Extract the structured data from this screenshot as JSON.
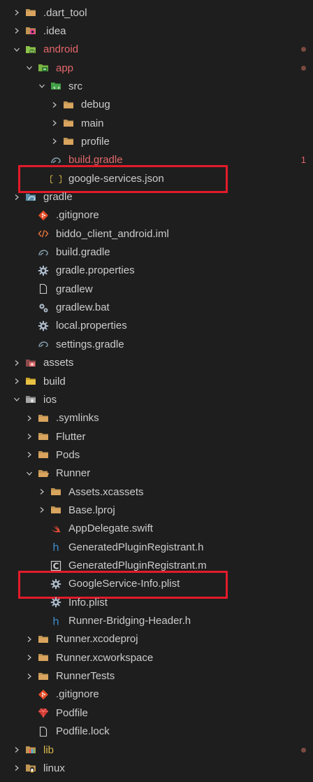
{
  "colors": {
    "background": "#1e1e1e",
    "text": "#cccccc",
    "modified_text": "#e4676b",
    "untracked_text": "#d9b84c",
    "highlight_box": "#e21b2a"
  },
  "tree": [
    {
      "label": ".dart_tool",
      "depth": 0,
      "chevron": "right",
      "icon": "folder-icon"
    },
    {
      "label": ".idea",
      "depth": 0,
      "chevron": "right",
      "icon": "idea-folder-icon"
    },
    {
      "label": "android",
      "depth": 0,
      "chevron": "down",
      "icon": "android-folder-icon",
      "status": "modified",
      "badge": "dot"
    },
    {
      "label": "app",
      "depth": 1,
      "chevron": "down",
      "icon": "app-folder-icon",
      "status": "modified",
      "badge": "dot"
    },
    {
      "label": "src",
      "depth": 2,
      "chevron": "down",
      "icon": "src-folder-icon"
    },
    {
      "label": "debug",
      "depth": 3,
      "chevron": "right",
      "icon": "folder-icon"
    },
    {
      "label": "main",
      "depth": 3,
      "chevron": "right",
      "icon": "folder-icon"
    },
    {
      "label": "profile",
      "depth": 3,
      "chevron": "right",
      "icon": "folder-icon"
    },
    {
      "label": "build.gradle",
      "depth": 2,
      "chevron": "none",
      "icon": "gradle-icon",
      "status": "modified",
      "badge": "1"
    },
    {
      "label": "google-services.json",
      "depth": 2,
      "chevron": "none",
      "icon": "json-icon"
    },
    {
      "label": "gradle",
      "depth": 0,
      "chevron": "right",
      "icon": "gradle-folder-icon"
    },
    {
      "label": ".gitignore",
      "depth": 1,
      "chevron": "none",
      "icon": "git-icon"
    },
    {
      "label": "biddo_client_android.iml",
      "depth": 1,
      "chevron": "none",
      "icon": "code-icon"
    },
    {
      "label": "build.gradle",
      "depth": 1,
      "chevron": "none",
      "icon": "gradle-icon"
    },
    {
      "label": "gradle.properties",
      "depth": 1,
      "chevron": "none",
      "icon": "gear-icon"
    },
    {
      "label": "gradlew",
      "depth": 1,
      "chevron": "none",
      "icon": "file-icon"
    },
    {
      "label": "gradlew.bat",
      "depth": 1,
      "chevron": "none",
      "icon": "gears-icon"
    },
    {
      "label": "local.properties",
      "depth": 1,
      "chevron": "none",
      "icon": "gear-icon"
    },
    {
      "label": "settings.gradle",
      "depth": 1,
      "chevron": "none",
      "icon": "gradle-icon"
    },
    {
      "label": "assets",
      "depth": 0,
      "chevron": "right",
      "icon": "assets-folder-icon"
    },
    {
      "label": "build",
      "depth": 0,
      "chevron": "right",
      "icon": "build-folder-icon"
    },
    {
      "label": "ios",
      "depth": 0,
      "chevron": "down",
      "icon": "ios-folder-icon"
    },
    {
      "label": ".symlinks",
      "depth": 1,
      "chevron": "right",
      "icon": "folder-icon"
    },
    {
      "label": "Flutter",
      "depth": 1,
      "chevron": "right",
      "icon": "folder-icon"
    },
    {
      "label": "Pods",
      "depth": 1,
      "chevron": "right",
      "icon": "folder-icon"
    },
    {
      "label": "Runner",
      "depth": 1,
      "chevron": "down",
      "icon": "folder-open-icon"
    },
    {
      "label": "Assets.xcassets",
      "depth": 2,
      "chevron": "right",
      "icon": "folder-icon"
    },
    {
      "label": "Base.lproj",
      "depth": 2,
      "chevron": "right",
      "icon": "folder-icon"
    },
    {
      "label": "AppDelegate.swift",
      "depth": 2,
      "chevron": "none",
      "icon": "swift-icon"
    },
    {
      "label": "GeneratedPluginRegistrant.h",
      "depth": 2,
      "chevron": "none",
      "icon": "h-icon"
    },
    {
      "label": "GeneratedPluginRegistrant.m",
      "depth": 2,
      "chevron": "none",
      "icon": "c-icon"
    },
    {
      "label": "GoogleService-Info.plist",
      "depth": 2,
      "chevron": "none",
      "icon": "gear-icon"
    },
    {
      "label": "Info.plist",
      "depth": 2,
      "chevron": "none",
      "icon": "gear-icon"
    },
    {
      "label": "Runner-Bridging-Header.h",
      "depth": 2,
      "chevron": "none",
      "icon": "h-icon"
    },
    {
      "label": "Runner.xcodeproj",
      "depth": 1,
      "chevron": "right",
      "icon": "folder-icon"
    },
    {
      "label": "Runner.xcworkspace",
      "depth": 1,
      "chevron": "right",
      "icon": "folder-icon"
    },
    {
      "label": "RunnerTests",
      "depth": 1,
      "chevron": "right",
      "icon": "folder-icon"
    },
    {
      "label": ".gitignore",
      "depth": 1,
      "chevron": "none",
      "icon": "git-icon"
    },
    {
      "label": "Podfile",
      "depth": 1,
      "chevron": "none",
      "icon": "ruby-icon"
    },
    {
      "label": "Podfile.lock",
      "depth": 1,
      "chevron": "none",
      "icon": "file-icon"
    },
    {
      "label": "lib",
      "depth": 0,
      "chevron": "right",
      "icon": "lib-folder-icon",
      "status": "untracked",
      "badge": "dot"
    },
    {
      "label": "linux",
      "depth": 0,
      "chevron": "right",
      "icon": "linux-folder-icon"
    }
  ],
  "highlighted": [
    "google-services.json",
    "GoogleService-Info.plist"
  ]
}
